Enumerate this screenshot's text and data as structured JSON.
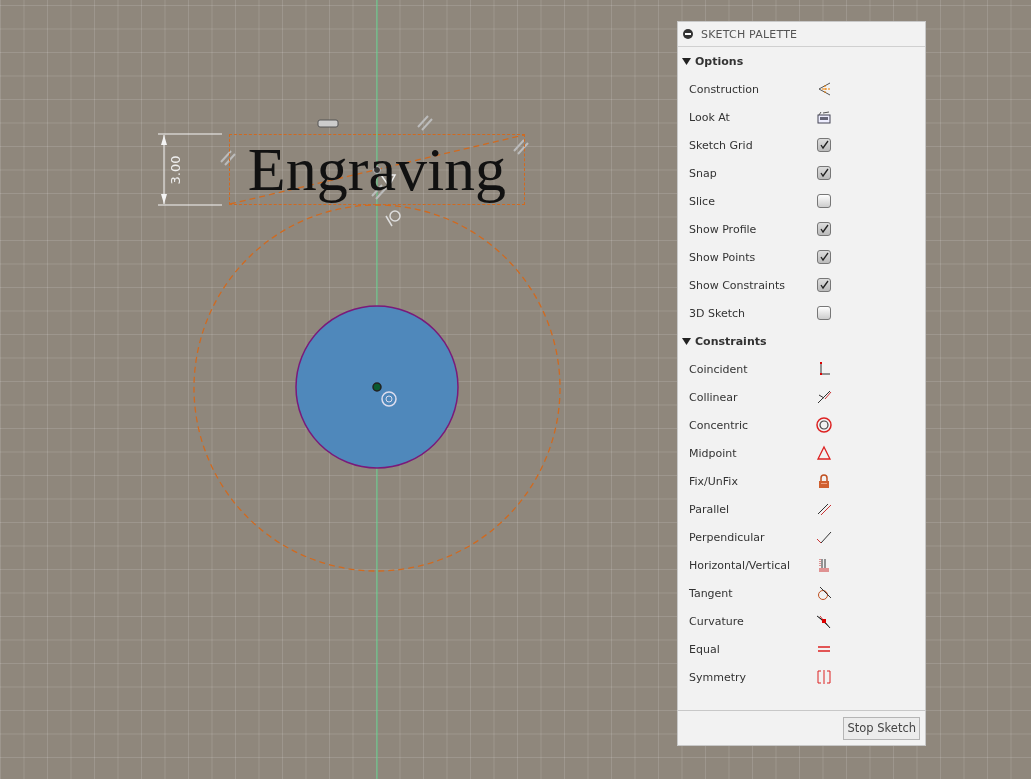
{
  "sketch": {
    "text": "Engraving",
    "dimension": "3.00"
  },
  "palette": {
    "title": "SKETCH PALETTE",
    "sections": [
      {
        "label": "Options",
        "expanded": true,
        "items": [
          {
            "label": "Construction",
            "kind": "tool"
          },
          {
            "label": "Look At",
            "kind": "tool"
          },
          {
            "label": "Sketch Grid",
            "kind": "toggle",
            "checked": true
          },
          {
            "label": "Snap",
            "kind": "toggle",
            "checked": true
          },
          {
            "label": "Slice",
            "kind": "toggle",
            "checked": false
          },
          {
            "label": "Show Profile",
            "kind": "toggle",
            "checked": true
          },
          {
            "label": "Show Points",
            "kind": "toggle",
            "checked": true
          },
          {
            "label": "Show Constraints",
            "kind": "toggle",
            "checked": true
          },
          {
            "label": "3D Sketch",
            "kind": "toggle",
            "checked": false
          }
        ]
      },
      {
        "label": "Constraints",
        "expanded": true,
        "items": [
          {
            "label": "Coincident",
            "kind": "tool"
          },
          {
            "label": "Collinear",
            "kind": "tool"
          },
          {
            "label": "Concentric",
            "kind": "tool"
          },
          {
            "label": "Midpoint",
            "kind": "tool"
          },
          {
            "label": "Fix/UnFix",
            "kind": "tool"
          },
          {
            "label": "Parallel",
            "kind": "tool"
          },
          {
            "label": "Perpendicular",
            "kind": "tool"
          },
          {
            "label": "Horizontal/Vertical",
            "kind": "tool"
          },
          {
            "label": "Tangent",
            "kind": "tool"
          },
          {
            "label": "Curvature",
            "kind": "tool"
          },
          {
            "label": "Equal",
            "kind": "tool"
          },
          {
            "label": "Symmetry",
            "kind": "tool"
          }
        ]
      }
    ],
    "stop_button": "Stop Sketch"
  }
}
